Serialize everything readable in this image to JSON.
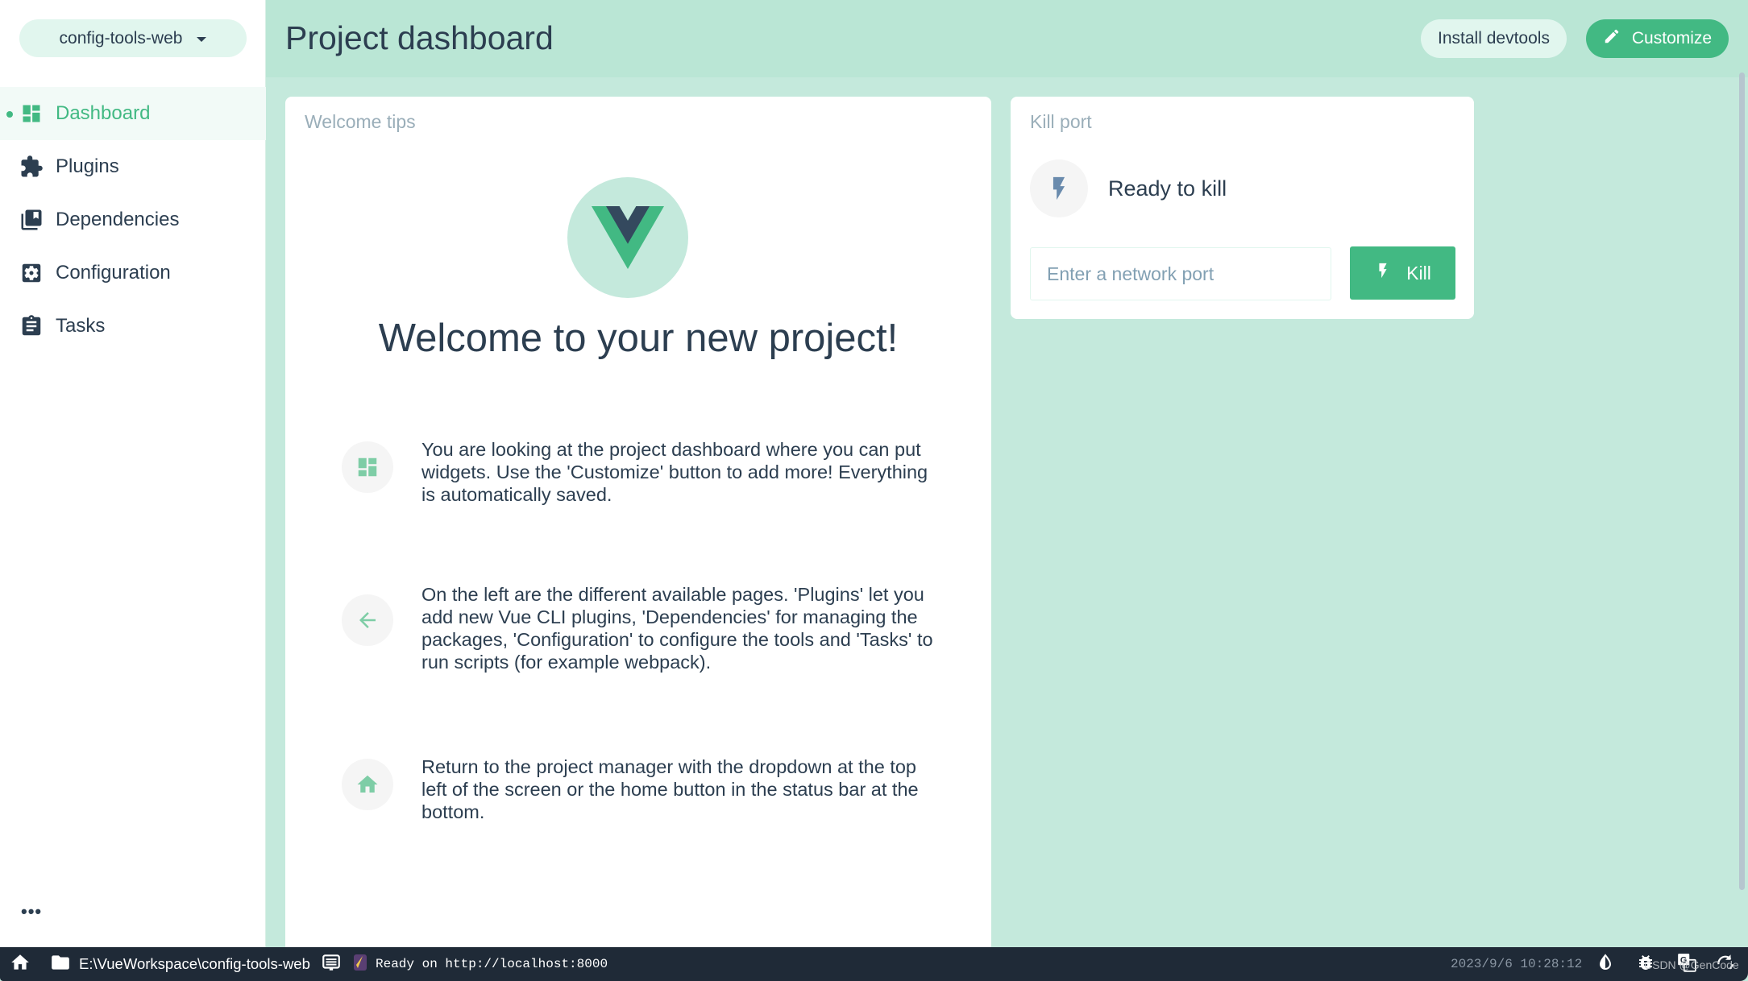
{
  "sidebar": {
    "project_selector": "config-tools-web",
    "items": [
      {
        "label": "Dashboard",
        "icon": "dashboard-icon",
        "active": true
      },
      {
        "label": "Plugins",
        "icon": "puzzle-icon",
        "active": false
      },
      {
        "label": "Dependencies",
        "icon": "library-books-icon",
        "active": false
      },
      {
        "label": "Configuration",
        "icon": "settings-applications-icon",
        "active": false
      },
      {
        "label": "Tasks",
        "icon": "clipboard-icon",
        "active": false
      }
    ],
    "more_label": "•••"
  },
  "header": {
    "title": "Project dashboard",
    "install_devtools_label": "Install devtools",
    "customize_label": "Customize"
  },
  "welcome_widget": {
    "title": "Welcome tips",
    "heading": "Welcome to your new project!",
    "tips": [
      {
        "icon": "dashboard-icon",
        "text": "You are looking at the project dashboard where you can put widgets. Use the 'Customize' button to add more! Everything is automatically saved."
      },
      {
        "icon": "arrow-back-icon",
        "text": "On the left are the different available pages. 'Plugins' let you add new Vue CLI plugins, 'Dependencies' for managing the packages, 'Configuration' to configure the tools and 'Tasks' to run scripts (for example webpack)."
      },
      {
        "icon": "home-icon",
        "text": "Return to the project manager with the dropdown at the top left of the screen or the home button in the status bar at the bottom."
      }
    ]
  },
  "kill_port_widget": {
    "title": "Kill port",
    "status": "Ready to kill",
    "port_input": {
      "value": "",
      "placeholder": "Enter a network port"
    },
    "kill_label": "Kill"
  },
  "statusbar": {
    "project_path": "E:\\VueWorkspace\\config-tools-web",
    "log_message": "Ready on http://localhost:8000",
    "clock": "2023/9/6 10:28:12",
    "watermark": "CSDN @GenCode"
  },
  "colors": {
    "accent": "#42b983",
    "header_bg": "#bae6d5",
    "content_bg": "#c4e9dc",
    "text": "#2c3e50",
    "statusbar_bg": "#1f2a37"
  }
}
